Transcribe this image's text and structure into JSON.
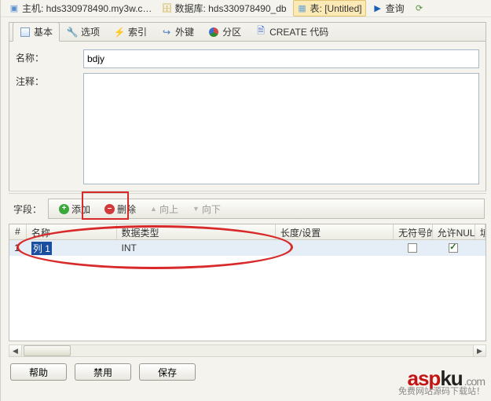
{
  "breadcrumbs": {
    "host_label": "主机: hds330978490.my3w.c…",
    "db_label": "数据库: hds330978490_db",
    "table_label": "表: [Untitled]",
    "query_label": "查询"
  },
  "tabs": {
    "basic": "基本",
    "options": "选项",
    "indexes": "索引",
    "foreign_keys": "外键",
    "partitions": "分区",
    "create_code": "CREATE 代码"
  },
  "form": {
    "name_label": "名称：",
    "name_value": "bdjy",
    "comment_label": "注释：",
    "comment_value": ""
  },
  "fields": {
    "label": "字段：",
    "add": "添加",
    "remove": "删除",
    "move_up": "向上",
    "move_down": "向下"
  },
  "grid": {
    "headers": {
      "idx": "#",
      "name": "名称",
      "type": "数据类型",
      "len": "长度/设置",
      "unsigned": "无符号的",
      "allow_null": "允许NULL",
      "fill": "填"
    },
    "rows": [
      {
        "idx": "1",
        "name": "列 1",
        "type": "INT",
        "len": "",
        "unsigned": false,
        "allow_null": true
      }
    ]
  },
  "buttons": {
    "help": "帮助",
    "disable": "禁用",
    "save": "保存"
  },
  "watermark": {
    "brand_asp": "asp",
    "brand_ku": "ku",
    "brand_com": ".com",
    "subtitle": "免费网站源码下载站！"
  }
}
